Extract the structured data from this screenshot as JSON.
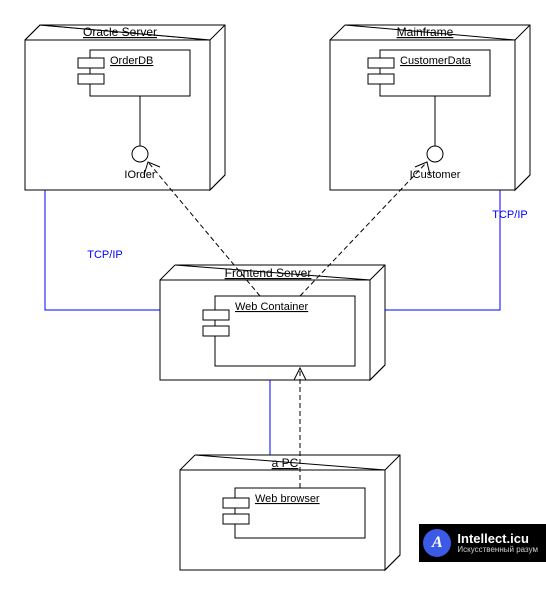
{
  "nodes": {
    "oracle": {
      "title": "Oracle Server",
      "component": "OrderDB",
      "interface": "IOrder"
    },
    "mainframe": {
      "title": "Mainframe",
      "component": "CustomerData",
      "interface": "ICustomer"
    },
    "frontend": {
      "title": "Frontend Server",
      "component": "Web Container"
    },
    "pc": {
      "title": "a PC",
      "component": "Web browser"
    }
  },
  "links": {
    "oraFront": "TCP/IP",
    "mfFront": "TCP/IP"
  },
  "watermark": {
    "letter": "A",
    "title": "Intellect.icu",
    "subtitle": "Искусственный разум"
  }
}
